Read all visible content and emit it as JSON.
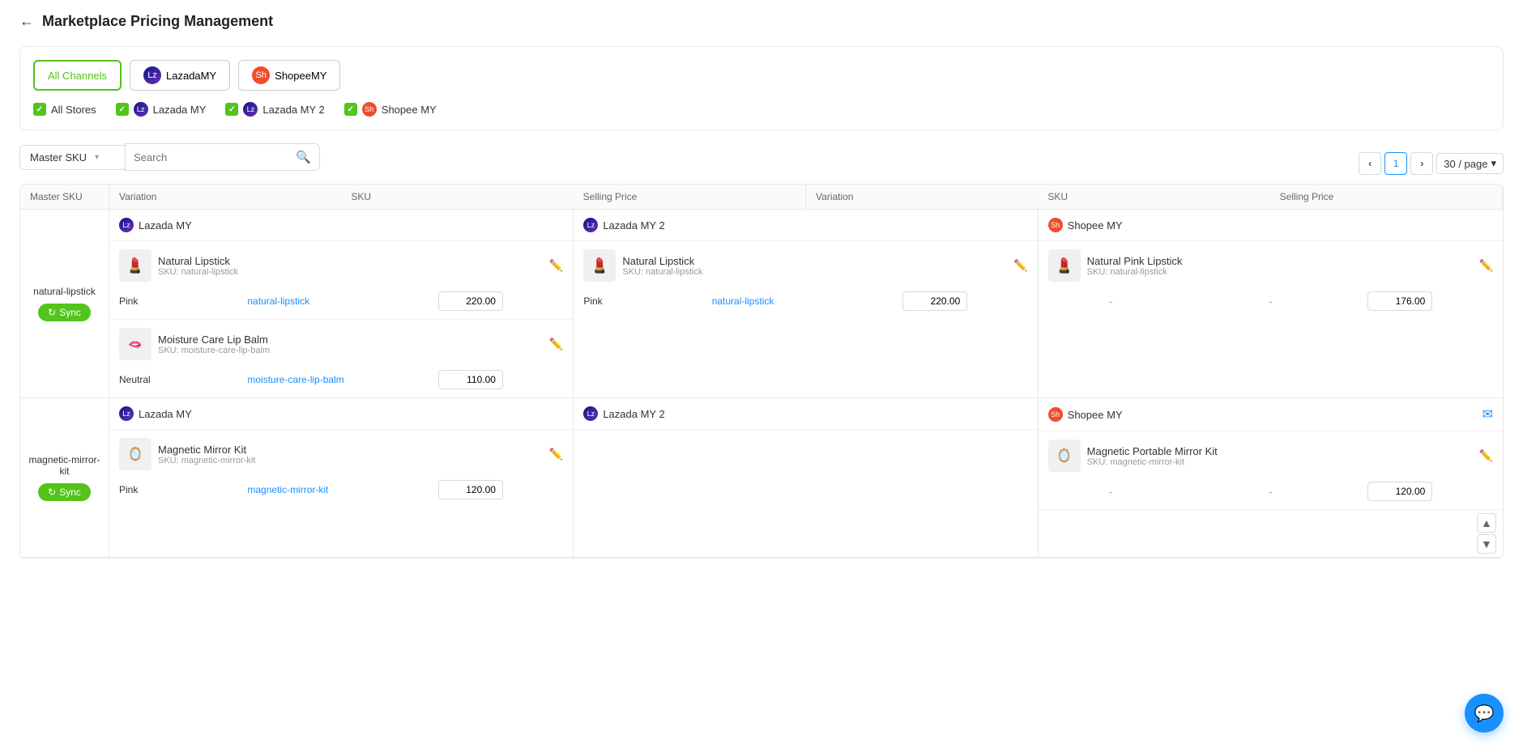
{
  "page": {
    "title": "Marketplace Pricing Management",
    "back_label": "←"
  },
  "channels": {
    "tabs": [
      {
        "id": "all",
        "label": "All Channels",
        "active": true
      },
      {
        "id": "lazada",
        "label": "LazadaMY",
        "icon": "lazada"
      },
      {
        "id": "shopee",
        "label": "ShopeeMY",
        "icon": "shopee"
      }
    ],
    "stores": [
      {
        "id": "all",
        "label": "All Stores",
        "checked": true
      },
      {
        "id": "lazada-my",
        "label": "Lazada MY",
        "checked": true,
        "icon": "lazada"
      },
      {
        "id": "lazada-my2",
        "label": "Lazada MY 2",
        "checked": true,
        "icon": "lazada"
      },
      {
        "id": "shopee-my",
        "label": "Shopee MY",
        "checked": true,
        "icon": "shopee"
      }
    ]
  },
  "search": {
    "dropdown_label": "Master SKU",
    "placeholder": "Search",
    "search_icon": "🔍"
  },
  "pagination": {
    "current_page": "1",
    "page_size": "30 / page",
    "prev_icon": "‹",
    "next_icon": "›"
  },
  "table": {
    "columns": [
      {
        "label": "Master SKU"
      },
      {
        "label": "Variation"
      },
      {
        "label": "SKU"
      },
      {
        "label": "Selling Price"
      },
      {
        "label": "Variation"
      },
      {
        "label": "SKU"
      },
      {
        "label": "Selling Price"
      },
      {
        "label": "Variation"
      },
      {
        "label": "SKU"
      },
      {
        "label": "Selling Price"
      }
    ],
    "rows": [
      {
        "master_sku": "natural-lipstick",
        "sync_label": "Sync",
        "stores": [
          {
            "store_name": "Lazada MY",
            "store_icon": "lazada",
            "products": [
              {
                "name": "Natural Lipstick",
                "sku_label": "SKU: natural-lipstick",
                "thumb_emoji": "💄",
                "variations": [
                  {
                    "variation": "Pink",
                    "sku": "natural-lipstick",
                    "price": "220.00"
                  }
                ]
              },
              {
                "name": "Moisture Care Lip Balm",
                "sku_label": "SKU: moisture-care-lip-balm",
                "thumb_emoji": "💋",
                "variations": [
                  {
                    "variation": "Neutral",
                    "sku": "moisture-care-lip-balm",
                    "price": "110.00"
                  }
                ]
              }
            ]
          },
          {
            "store_name": "Lazada MY 2",
            "store_icon": "lazada",
            "products": [
              {
                "name": "Natural Lipstick",
                "sku_label": "SKU: natural-lipstick",
                "thumb_emoji": "💄",
                "variations": [
                  {
                    "variation": "Pink",
                    "sku": "natural-lipstick",
                    "price": "220.00"
                  }
                ]
              }
            ]
          },
          {
            "store_name": "Shopee MY",
            "store_icon": "shopee",
            "products": [
              {
                "name": "Natural Pink Lipstick",
                "sku_label": "SKU: natural-lipstick",
                "thumb_emoji": "💄",
                "variations": [
                  {
                    "variation": "-",
                    "sku": "-",
                    "price": "176.00"
                  }
                ]
              }
            ]
          }
        ]
      },
      {
        "master_sku": "magnetic-mirror-kit",
        "sync_label": "Sync",
        "stores": [
          {
            "store_name": "Lazada MY",
            "store_icon": "lazada",
            "products": [
              {
                "name": "Magnetic Mirror Kit",
                "sku_label": "SKU: magnetic-mirror-kit",
                "thumb_emoji": "🪞",
                "variations": [
                  {
                    "variation": "Pink",
                    "sku": "magnetic-mirror-kit",
                    "price": "120.00"
                  }
                ]
              }
            ]
          },
          {
            "store_name": "Lazada MY 2",
            "store_icon": "lazada",
            "products": []
          },
          {
            "store_name": "Shopee MY",
            "store_icon": "shopee",
            "products": [
              {
                "name": "Magnetic Portable Mirror Kit",
                "sku_label": "SKU: magnetic-mirror-kit",
                "thumb_emoji": "🪞",
                "variations": [
                  {
                    "variation": "-",
                    "sku": "-",
                    "price": "120.00"
                  }
                ]
              }
            ]
          }
        ]
      }
    ]
  },
  "fab": {
    "icon": "💬"
  }
}
